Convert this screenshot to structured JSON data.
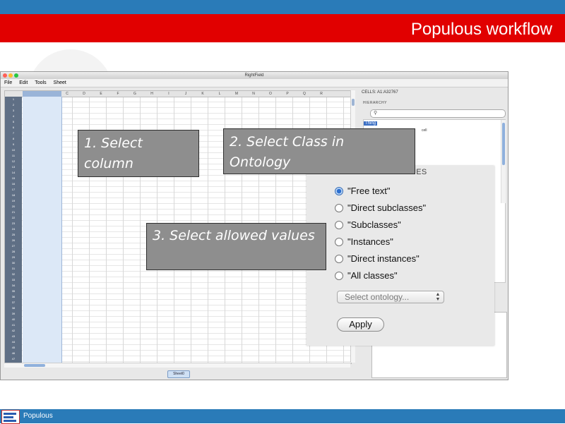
{
  "slide": {
    "title": "Populous workflow",
    "footer_text": "Populous"
  },
  "app": {
    "window_title": "RightField",
    "menu": [
      "File",
      "Edit",
      "Tools",
      "Sheet"
    ],
    "columns": [
      "A",
      "B",
      "C",
      "D",
      "E",
      "F",
      "G",
      "H",
      "I",
      "J",
      "K",
      "L",
      "M",
      "N",
      "O",
      "P",
      "Q",
      "R"
    ],
    "rows": [
      "1",
      "2",
      "3",
      "4",
      "5",
      "6",
      "7",
      "8",
      "9",
      "10",
      "11",
      "12",
      "13",
      "14",
      "15",
      "16",
      "17",
      "18",
      "19",
      "20",
      "21",
      "22",
      "23",
      "24",
      "25",
      "26",
      "27",
      "28",
      "29",
      "30",
      "31",
      "32",
      "33",
      "34",
      "35",
      "36",
      "37",
      "38",
      "39",
      "40",
      "41",
      "42",
      "43",
      "44",
      "45",
      "46",
      "47"
    ],
    "sheet_tab": "Sheet0",
    "cells_label": "CELLS: A1:A32767",
    "hierarchy_label": "HIERARCHY",
    "search_icon": "magnifier",
    "tree_root": "Thing",
    "tree_item_partial": "cell",
    "tree_item_partial_2": "f"
  },
  "popup": {
    "title": "TYPE OF ALLOWED VALUES",
    "options": [
      {
        "label": "\"Free text\"",
        "selected": true
      },
      {
        "label": "\"Direct subclasses\"",
        "selected": false
      },
      {
        "label": "\"Subclasses\"",
        "selected": false
      },
      {
        "label": "\"Instances\"",
        "selected": false
      },
      {
        "label": "\"Direct instances\"",
        "selected": false
      },
      {
        "label": "\"All classes\"",
        "selected": false
      }
    ],
    "ontology_select": "Select ontology...",
    "apply_label": "Apply"
  },
  "callouts": {
    "step1": "1. Select column",
    "step2": "2. Select Class in Ontology",
    "step3": "3. Select allowed values"
  },
  "colors": {
    "header_blue": "#2a7bb8",
    "header_red": "#e10000",
    "callout_gray": "#8e8e8e",
    "selected_blue": "#3b6fc4"
  }
}
